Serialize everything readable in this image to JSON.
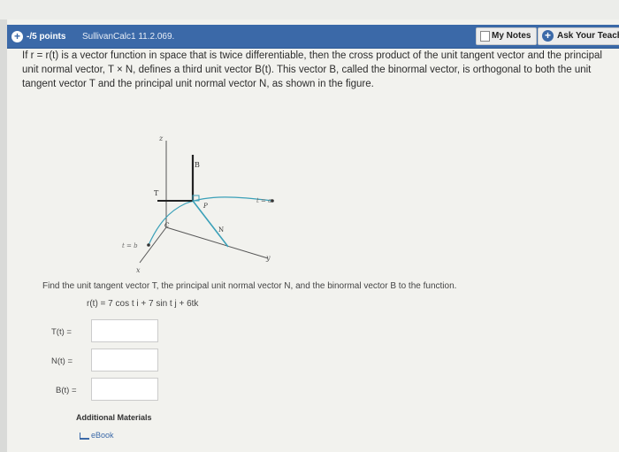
{
  "question": {
    "points": "-/5 points",
    "problem_id": "SullivanCalc1 11.2.069.",
    "my_notes": "My Notes",
    "ask_teacher": "Ask Your Teacher",
    "intro": "If r = r(t) is a vector function in space that is twice differentiable, then the cross product of the unit tangent vector and the principal unit normal vector, T × N, defines a third unit vector B(t). This vector B, called the binormal vector, is orthogonal to both the unit tangent vector T and the principal unit normal vector N, as shown in the figure.",
    "find_text": "Find the unit tangent vector T, the principal unit normal vector N, and the binormal vector B to the function.",
    "function": "r(t) = 7 cos t i + 7 sin t j + 6tk"
  },
  "figure": {
    "z_label": "z",
    "x_label": "x",
    "y_label": "y",
    "B_label": "B",
    "T_label": "T",
    "P_label": "P",
    "N_label": "N",
    "C_label": "C",
    "t_a_label": "t = a",
    "t_b_label": "t = b"
  },
  "answers": {
    "T_label": "T(t) =",
    "N_label": "N(t) =",
    "B_label": "B(t) =",
    "T_value": "",
    "N_value": "",
    "B_value": ""
  },
  "additional_materials": "Additional Materials",
  "ebook": "eBook"
}
